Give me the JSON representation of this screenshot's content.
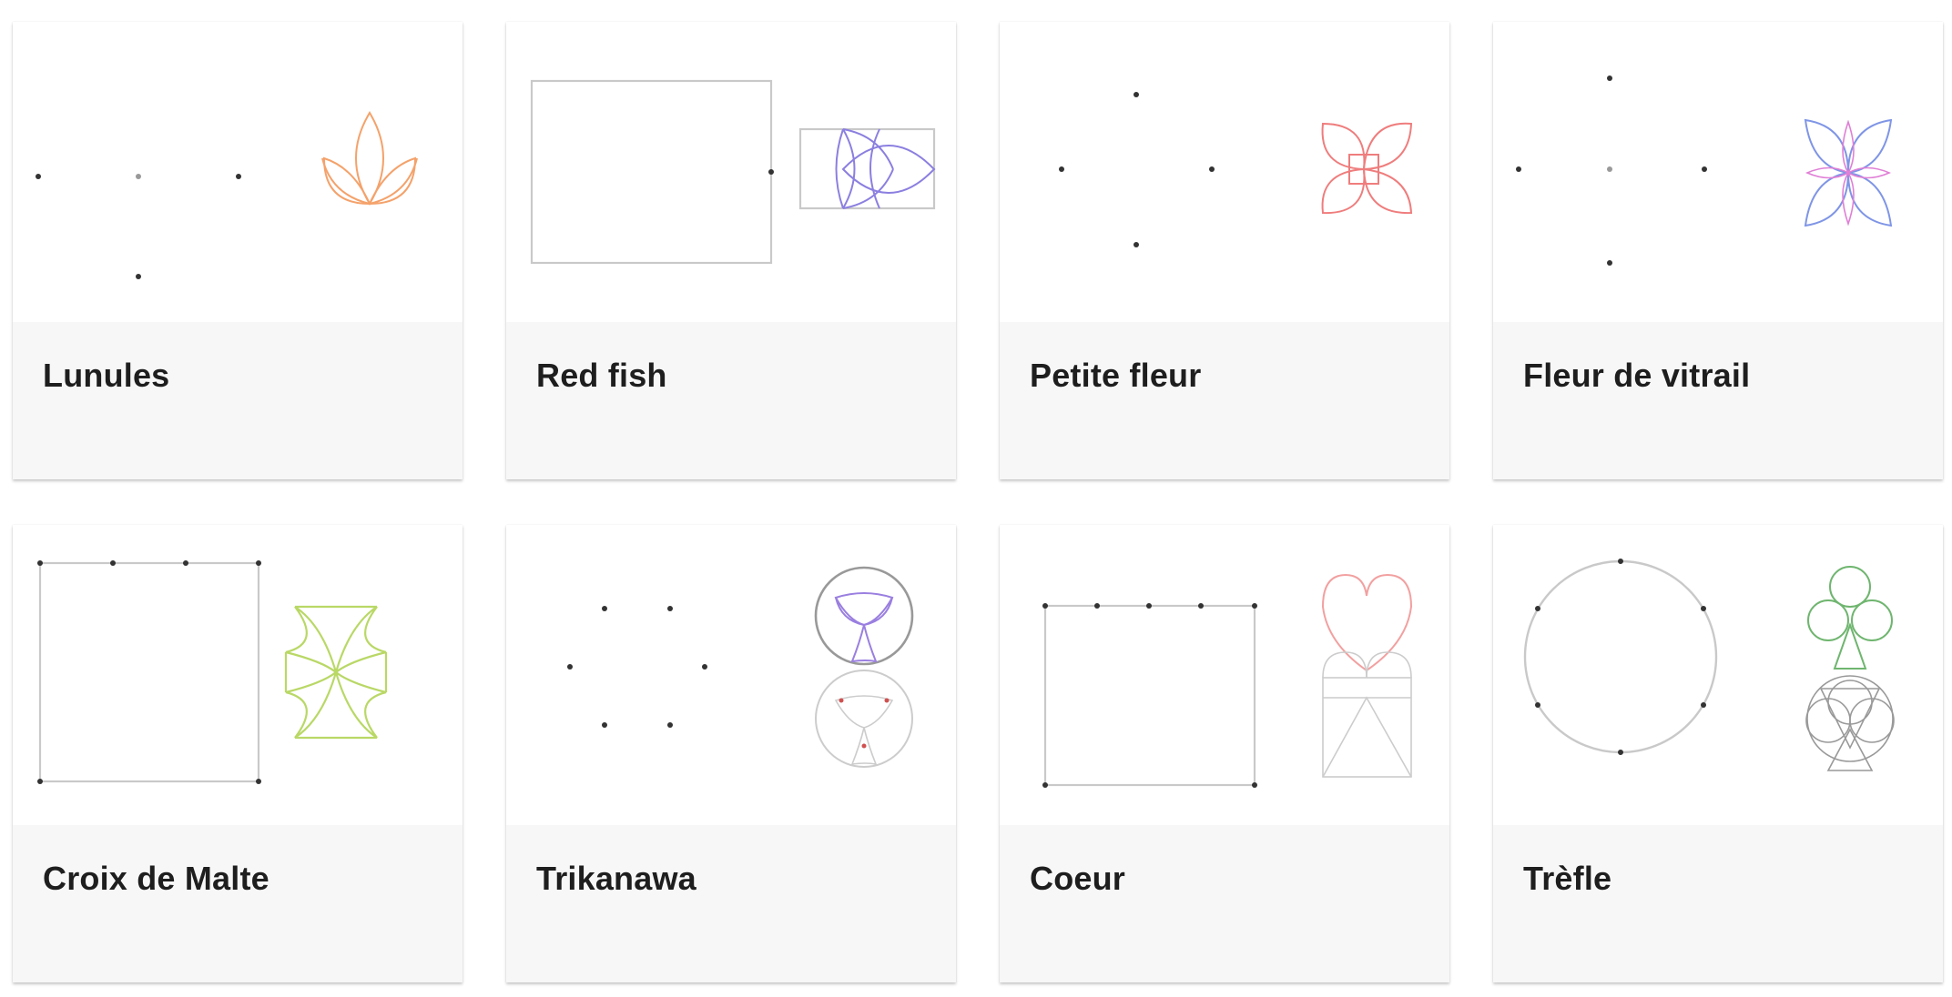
{
  "cards": [
    {
      "title": "Lunules",
      "accent": "#f4a26b"
    },
    {
      "title": "Red fish",
      "accent": "#8b7fe0"
    },
    {
      "title": "Petite fleur",
      "accent": "#ef7d7d"
    },
    {
      "title": "Fleur de vitrail",
      "accent_primary": "#7f95e6",
      "accent_secondary": "#e07fd6"
    },
    {
      "title": "Croix de Malte",
      "accent": "#b9d866"
    },
    {
      "title": "Trikanawa",
      "accent": "#9a7fe0",
      "secondary_accent": "#d05050"
    },
    {
      "title": "Coeur",
      "accent": "#f2a0a0"
    },
    {
      "title": "Trèfle",
      "accent": "#6fb56f"
    }
  ]
}
